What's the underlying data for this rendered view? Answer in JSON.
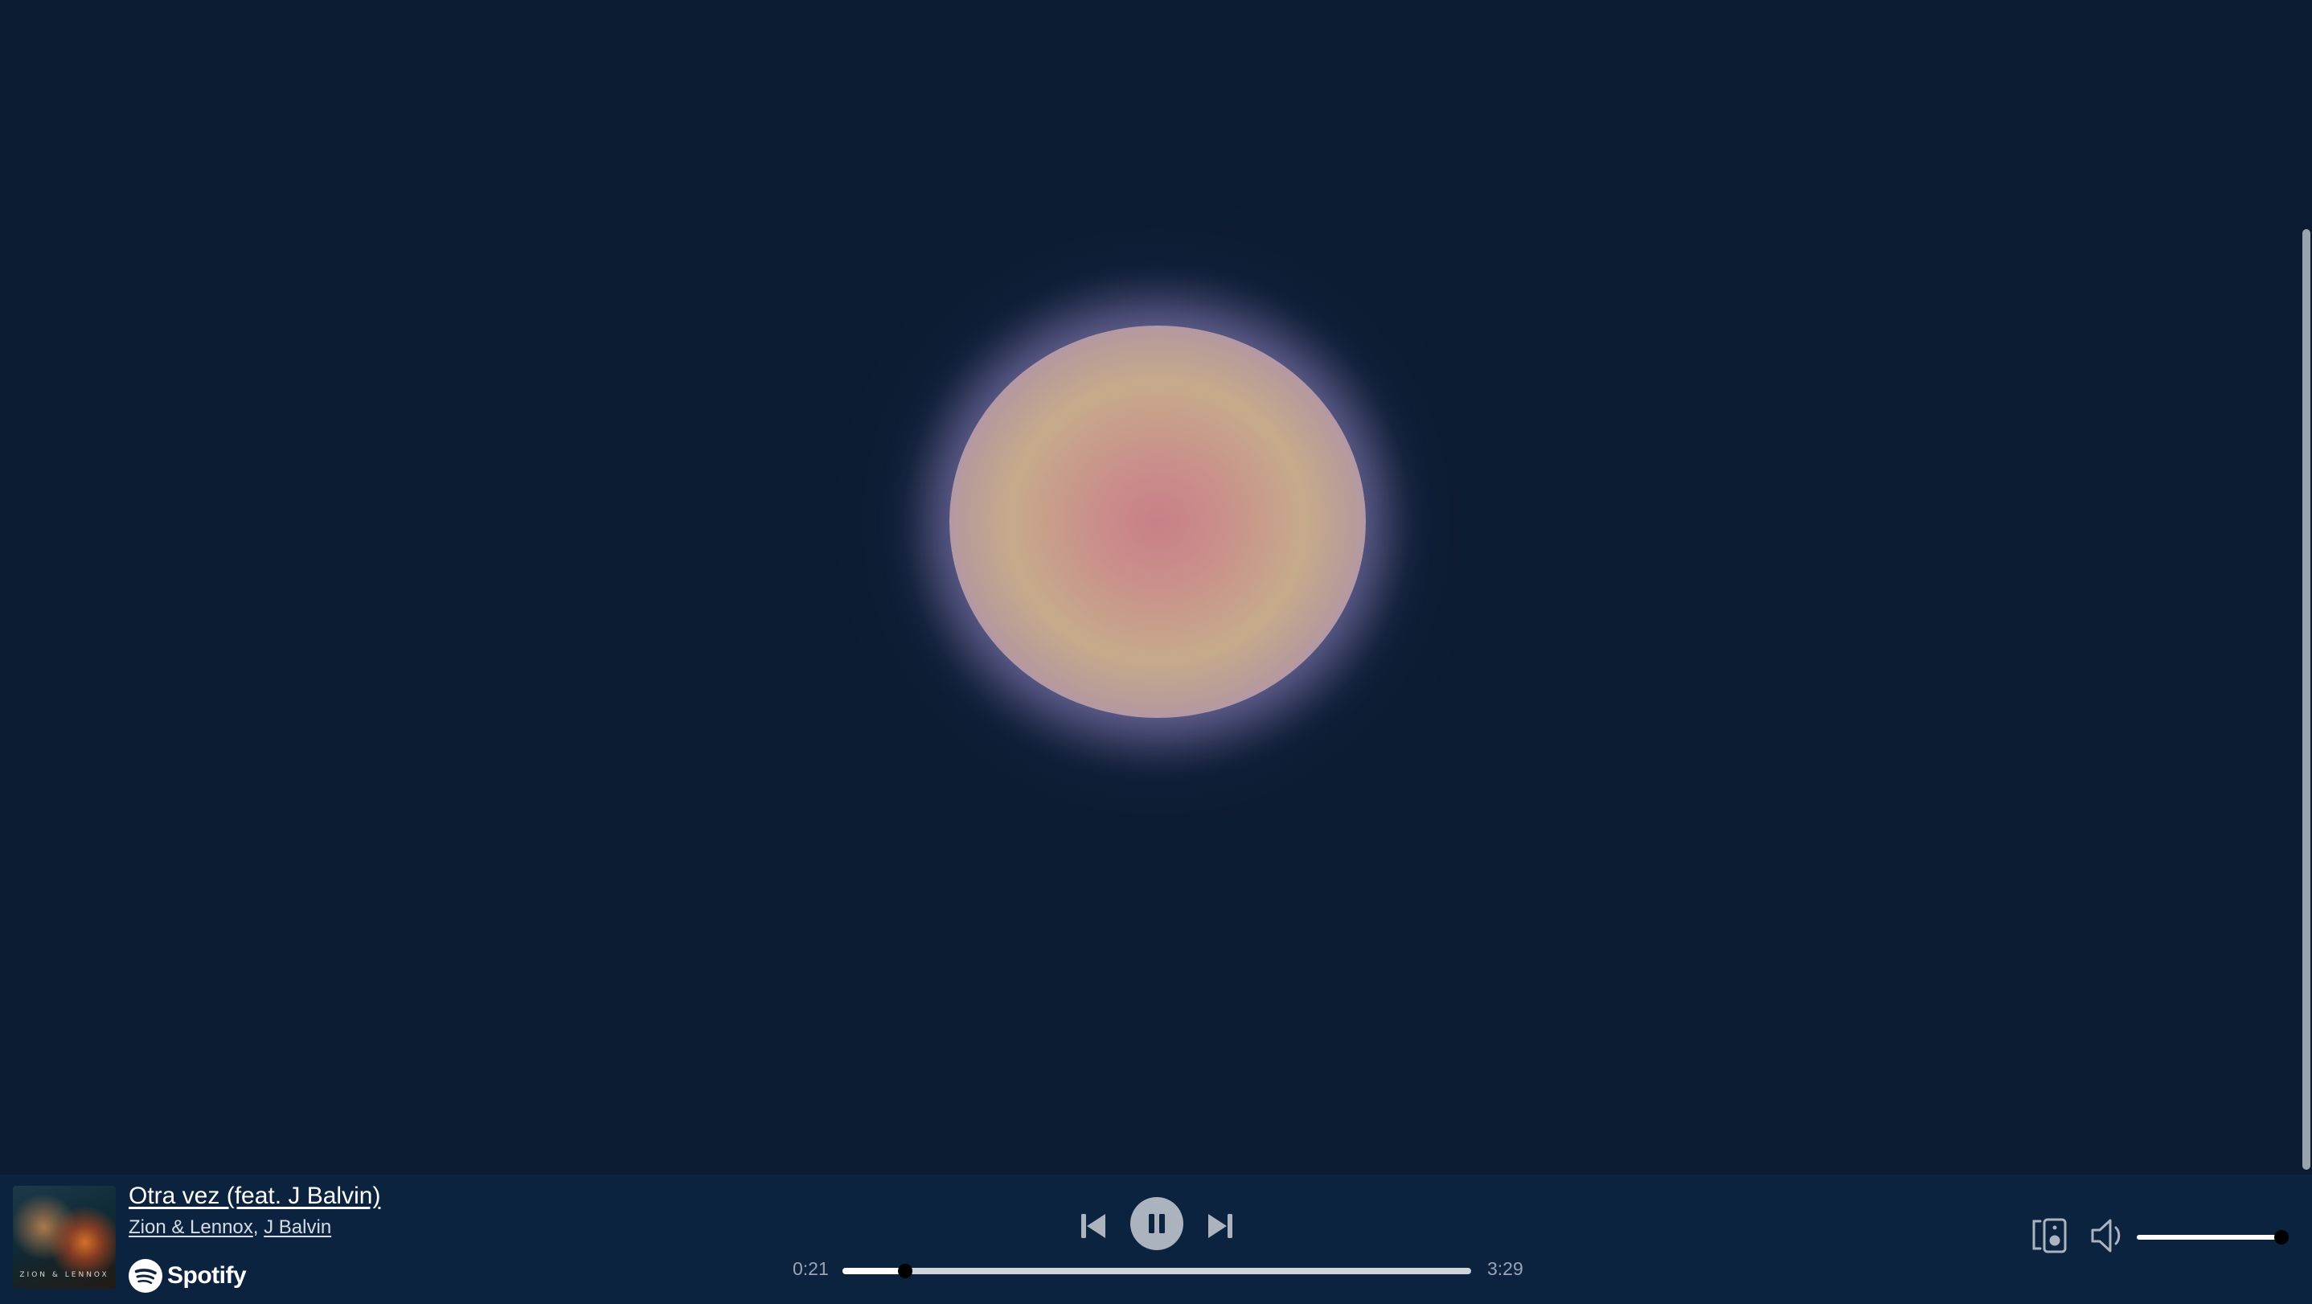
{
  "track": {
    "title": "Otra vez (feat. J Balvin)",
    "artists": [
      "Zion & Lennox",
      "J Balvin"
    ],
    "artist_separator": ", ",
    "album_art_caption": "ZION & LENNOX"
  },
  "brand": {
    "name": "Spotify",
    "icon": "spotify-icon"
  },
  "playback": {
    "state": "playing",
    "current_time": "0:21",
    "total_time": "3:29",
    "progress_fraction": 0.1,
    "volume_fraction": 1.0
  },
  "controls": {
    "previous_icon": "skip-previous-icon",
    "play_pause_icon": "pause-icon",
    "next_icon": "skip-next-icon",
    "device_icon": "speaker-device-icon",
    "volume_icon": "volume-icon"
  },
  "colors": {
    "background": "#0b1b31",
    "player_bar": "#0c2340",
    "control_grey": "#aab3be",
    "orb_outer": "#a98fd2",
    "orb_mid": "#c6ab8b",
    "orb_center": "#c97f8a"
  }
}
